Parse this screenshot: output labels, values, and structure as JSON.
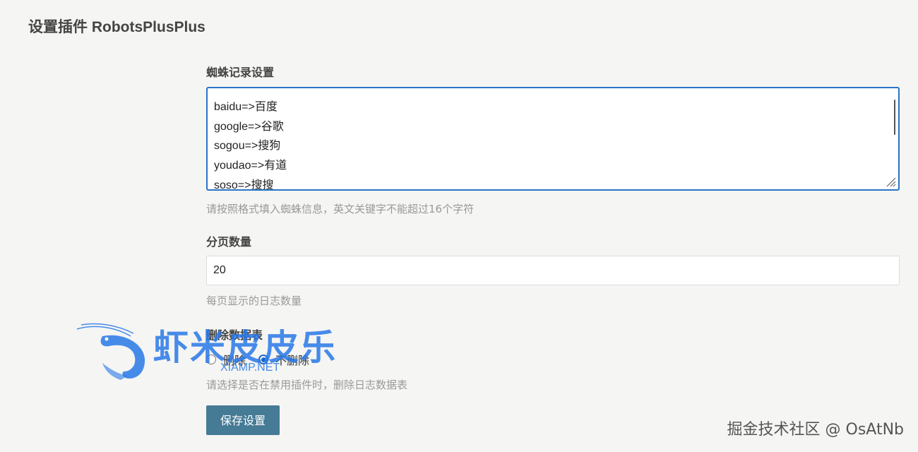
{
  "page_title": "设置插件 RobotsPlusPlus",
  "spider_section": {
    "label": "蜘蛛记录设置",
    "lines": [
      "baidu=>百度",
      "google=>谷歌",
      "sogou=>搜狗",
      "youdao=>有道",
      "soso=>搜搜"
    ],
    "hint": "请按照格式填入蜘蛛信息，英文关键字不能超过16个字符"
  },
  "page_size_section": {
    "label": "分页数量",
    "value": "20",
    "hint": "每页显示的日志数量"
  },
  "drop_table_section": {
    "label": "删除数据表",
    "options": [
      {
        "label": "删除",
        "checked": false
      },
      {
        "label": "不删除",
        "checked": true
      }
    ],
    "hint": "请选择是否在禁用插件时，删除日志数据表"
  },
  "save_button": {
    "label": "保存设置"
  },
  "watermark": {
    "title": "虾米皮皮乐",
    "subtitle": "XIAMP.NET",
    "color": "#2878e6"
  },
  "corner_watermark": "掘金技术社区 @ OsAtNb",
  "colors": {
    "accent": "#2a73c9",
    "button": "#467b96",
    "background": "#f5f5f3"
  }
}
